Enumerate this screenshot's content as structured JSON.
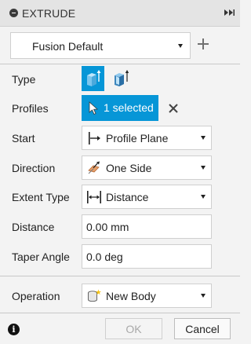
{
  "dialog": {
    "title": "EXTRUDE"
  },
  "preset": {
    "selected": "Fusion Default"
  },
  "fields": {
    "type": {
      "label": "Type",
      "selected_option": "one-side-solid"
    },
    "profiles": {
      "label": "Profiles",
      "value": "1 selected"
    },
    "start": {
      "label": "Start",
      "value": "Profile Plane",
      "icon": "profile-plane-icon"
    },
    "direction": {
      "label": "Direction",
      "value": "One Side",
      "icon": "one-side-icon"
    },
    "extent_type": {
      "label": "Extent Type",
      "value": "Distance",
      "icon": "distance-icon"
    },
    "distance": {
      "label": "Distance",
      "value": "0.00 mm"
    },
    "taper_angle": {
      "label": "Taper Angle",
      "value": "0.0 deg"
    },
    "operation": {
      "label": "Operation",
      "value": "New Body",
      "icon": "new-body-icon"
    }
  },
  "footer": {
    "ok_label": "OK",
    "cancel_label": "Cancel",
    "ok_enabled": false
  },
  "colors": {
    "accent": "#0696d7",
    "header_bg": "#e4e4e4",
    "panel_bg": "#f3f3f3",
    "disabled_text": "#a9a9a9"
  }
}
